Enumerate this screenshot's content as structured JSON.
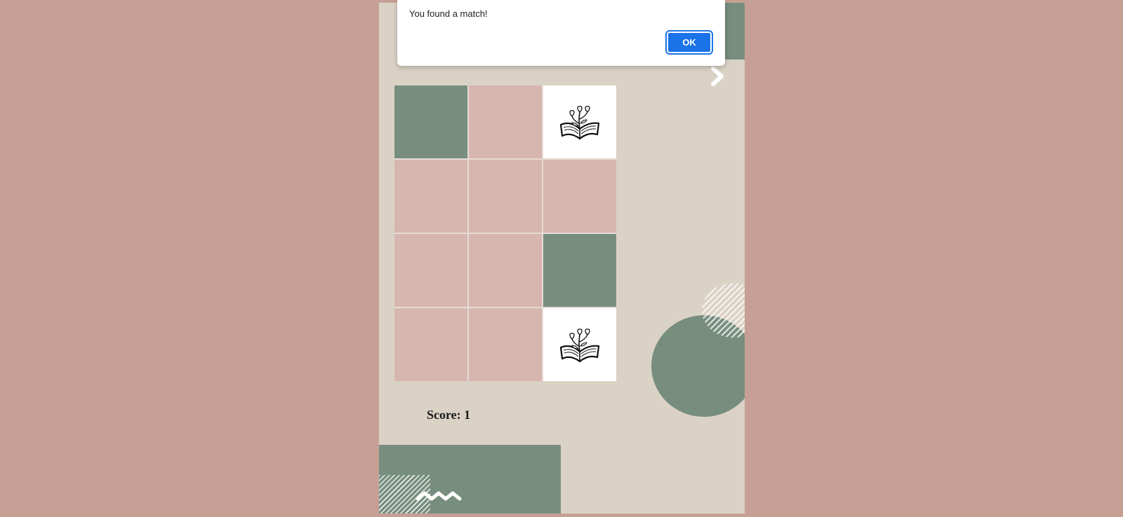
{
  "alert": {
    "message": "You found a match!",
    "ok_label": "OK"
  },
  "score": {
    "label": "Score: ",
    "value": "1"
  },
  "board": {
    "rows": 4,
    "cols": 3,
    "cards": [
      {
        "state": "matched"
      },
      {
        "state": "hidden"
      },
      {
        "state": "revealed",
        "icon": "book-flower-icon"
      },
      {
        "state": "hidden"
      },
      {
        "state": "hidden"
      },
      {
        "state": "hidden"
      },
      {
        "state": "hidden"
      },
      {
        "state": "hidden"
      },
      {
        "state": "matched"
      },
      {
        "state": "hidden"
      },
      {
        "state": "hidden"
      },
      {
        "state": "revealed",
        "icon": "book-flower-icon"
      }
    ]
  },
  "colors": {
    "page_bg": "#c7a095",
    "panel_bg": "#dbd2c6",
    "card_hidden": "#d6b6ae",
    "card_matched": "#778e7f",
    "card_revealed": "#ffffff",
    "accent_button": "#1a73e8"
  }
}
